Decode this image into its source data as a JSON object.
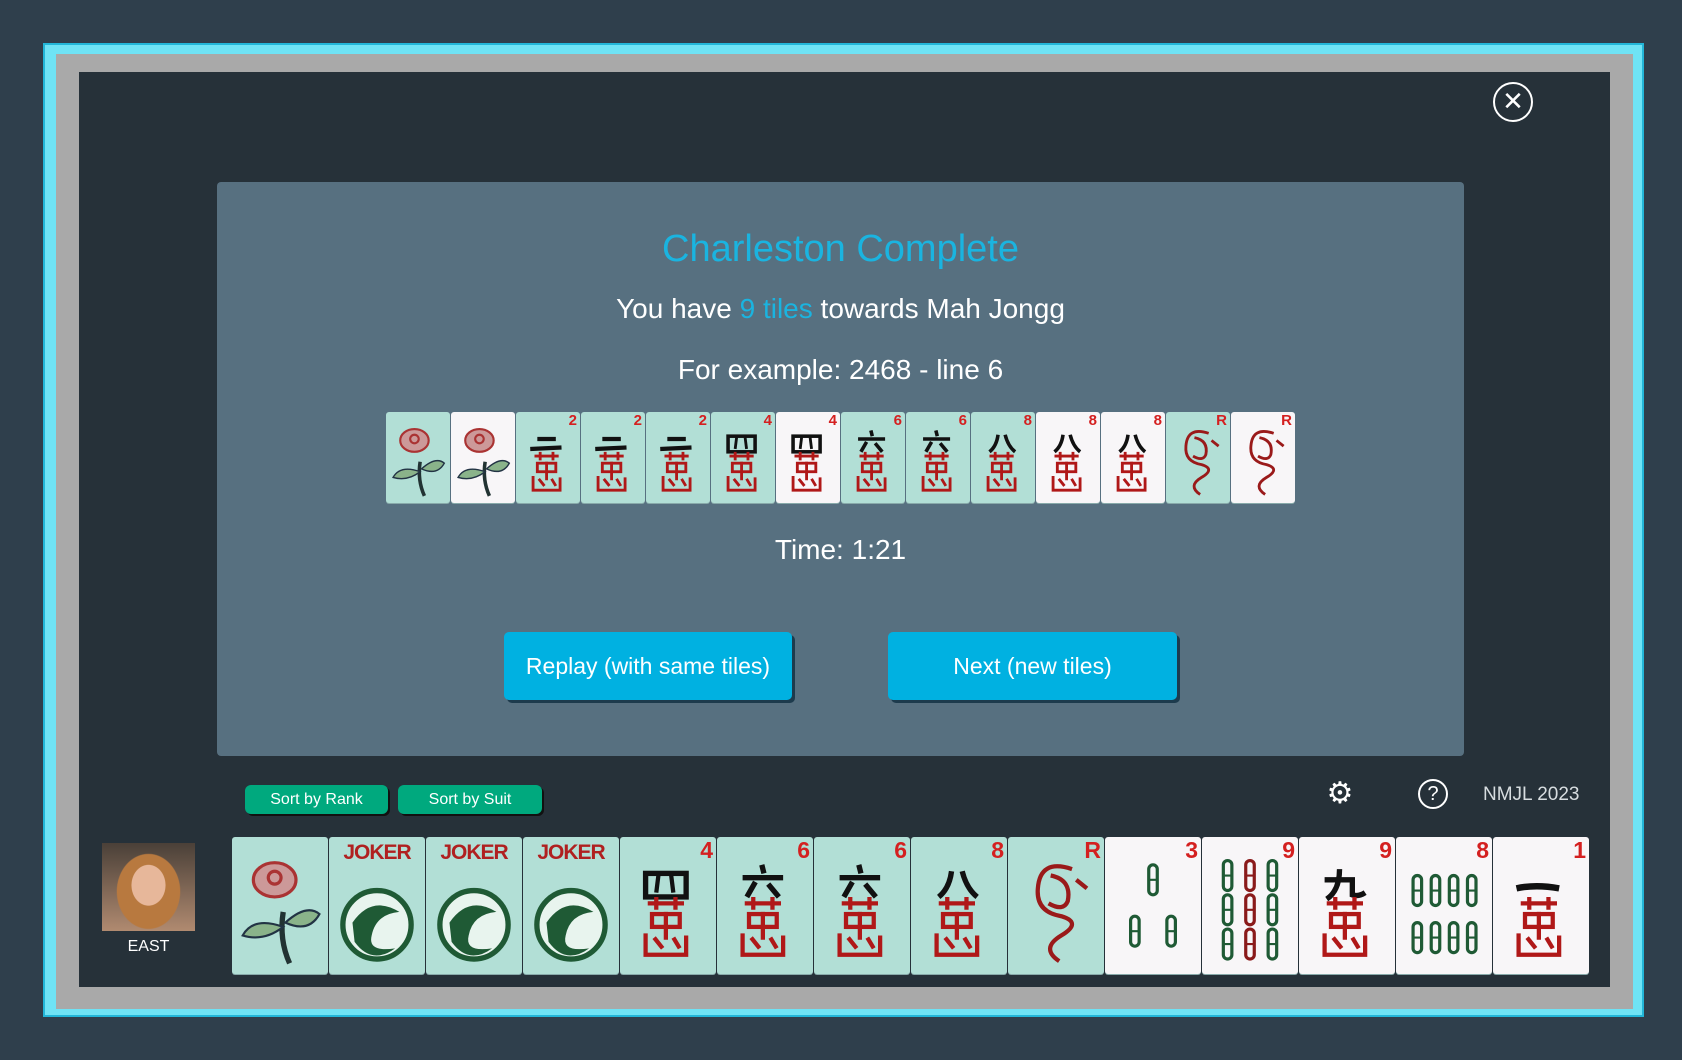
{
  "dialog": {
    "title": "Charleston Complete",
    "line2_pre": "You have ",
    "line2_count": "9 tiles",
    "line2_post": " towards Mah Jongg",
    "example": "For example: 2468 - line 6",
    "time": "Time: 1:21",
    "replay_label": "Replay (with same tiles)",
    "next_label": "Next (new tiles)",
    "close_icon": "close-icon"
  },
  "example_tiles": [
    {
      "type": "flower",
      "rank": "",
      "bg": "green"
    },
    {
      "type": "flower",
      "rank": "",
      "bg": "white"
    },
    {
      "type": "crak",
      "rank": "2",
      "bg": "green"
    },
    {
      "type": "crak",
      "rank": "2",
      "bg": "green"
    },
    {
      "type": "crak",
      "rank": "2",
      "bg": "green"
    },
    {
      "type": "crak",
      "rank": "4",
      "bg": "green"
    },
    {
      "type": "crak",
      "rank": "4",
      "bg": "white"
    },
    {
      "type": "crak",
      "rank": "6",
      "bg": "green"
    },
    {
      "type": "crak",
      "rank": "6",
      "bg": "green"
    },
    {
      "type": "crak",
      "rank": "8",
      "bg": "green"
    },
    {
      "type": "crak",
      "rank": "8",
      "bg": "white"
    },
    {
      "type": "crak",
      "rank": "8",
      "bg": "white"
    },
    {
      "type": "dragon",
      "rank": "R",
      "bg": "green"
    },
    {
      "type": "dragon",
      "rank": "R",
      "bg": "white"
    }
  ],
  "toolbar": {
    "sort_rank": "Sort by Rank",
    "sort_suit": "Sort by Suit",
    "settings_icon": "gear-icon",
    "help_icon": "help-icon",
    "help_label": "?",
    "card_year": "NMJL 2023"
  },
  "player": {
    "seat": "EAST"
  },
  "hand_tiles": [
    {
      "type": "flower",
      "rank": "",
      "bg": "green"
    },
    {
      "type": "joker",
      "rank": "",
      "label": "JOKER",
      "bg": "green"
    },
    {
      "type": "joker",
      "rank": "",
      "label": "JOKER",
      "bg": "green"
    },
    {
      "type": "joker",
      "rank": "",
      "label": "JOKER",
      "bg": "green"
    },
    {
      "type": "crak",
      "rank": "4",
      "bg": "green"
    },
    {
      "type": "crak",
      "rank": "6",
      "bg": "green"
    },
    {
      "type": "crak",
      "rank": "6",
      "bg": "green"
    },
    {
      "type": "crak",
      "rank": "8",
      "bg": "green"
    },
    {
      "type": "dragon",
      "rank": "R",
      "bg": "green"
    },
    {
      "type": "bam",
      "rank": "3",
      "bg": "white"
    },
    {
      "type": "bam",
      "rank": "9",
      "bg": "white"
    },
    {
      "type": "crak",
      "rank": "9",
      "bg": "white"
    },
    {
      "type": "bam",
      "rank": "8",
      "bg": "white"
    },
    {
      "type": "crak",
      "rank": "1",
      "bg": "white"
    }
  ],
  "colors": {
    "accent": "#1ab4e0",
    "tile_green": "#b2dfd6",
    "tile_white": "#f8f6f8",
    "rank_red": "#d42020",
    "sort_button": "#00a97e"
  }
}
